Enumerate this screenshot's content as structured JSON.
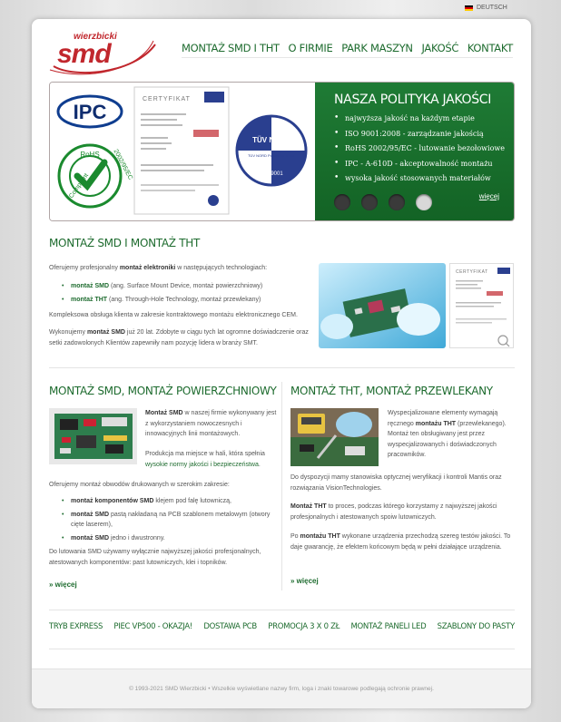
{
  "lang": {
    "label": "DEUTSCH"
  },
  "logo": {
    "top_word": "wierzbicki",
    "main_word": "smd"
  },
  "nav": [
    "MONTAŻ SMD I THT",
    "O FIRMIE",
    "PARK MASZYN",
    "JAKOŚĆ",
    "KONTAKT"
  ],
  "slider": {
    "title": "NASZA POLITYKA JAKOŚCI",
    "items": [
      "najwyższa jakość na każdym etapie",
      "ISO 9001:2008 - zarządzanie jakością",
      "RoHS 2002/95/EC - lutowanie bezołowiowe",
      "IPC - A-610D - akceptowalność montażu",
      "wysoka jakość stosowanych materiałów"
    ],
    "more": "więcej",
    "badges": {
      "ipc": "IPC",
      "rohs_top": "RoHS",
      "rohs_left": "Compliant",
      "rohs_right": "2002/95/EC",
      "cert": "CERTYFIKAT",
      "tuv": "TÜV NORD",
      "tuv_sub": "TÜV NORD Polska Sp. z o.o.",
      "iso": "ISO 9001"
    }
  },
  "section1": {
    "title": "MONTAŻ SMD I MONTAŻ THT",
    "intro_pre": "Oferujemy profesjonalny ",
    "intro_bold": "montaż elektroniki",
    "intro_post": " w następujących technologiach:",
    "b1_bold": "montaż SMD",
    "b1_rest": " (ang. Surface Mount Device, montaż powierzchniowy)",
    "b2_bold": "montaż THT",
    "b2_rest": " (ang. Through-Hole Technology, montaż przewlekany)",
    "p2": "Kompleksowa obsługa klienta w  zakresie kontraktowego montażu elektronicznego CEM.",
    "p3_pre": "Wykonujemy ",
    "p3_bold": "montaż SMD",
    "p3_post": " już 20 lat. Zdobyte w ciągu tych lat ogromne doświadczenie oraz setki zadowolonych Klientów zapewniły nam pozycję lidera w branży SMT.",
    "cert_label": "CERTYFIKAT"
  },
  "section2": {
    "title": "MONTAŻ SMD, MONTAŻ POWIERZCHNIOWY",
    "p1_bold": "Montaż SMD",
    "p1_rest": " w naszej firmie wykonywany jest z wykorzystaniem nowoczesnych i innowacyjnych linii montażowych.",
    "p2_pre": "Produkcja ma miejsce w hali, która spełnia ",
    "p2_link": "wysokie normy jakości i bezpieczeństwa",
    "p2_post": ".",
    "p3": "Oferujemy montaż obwodów drukowanych w szerokim zakresie:",
    "b1_bold": "montaż komponentów SMD",
    "b1_rest": " klejem pod falę lutowniczą,",
    "b2_bold": "montaż SMD",
    "b2_rest": " pastą nakładaną na PCB szablonem metalowym (otwory cięte laserem),",
    "b3_bold": "montaż SMD",
    "b3_rest": " jedno i dwustronny.",
    "p4": "Do lutowania SMD używamy wyłącznie najwyższej jakości profesjonalnych, atestowanych komponentów: past lutowniczych, klei i topników.",
    "more": "» więcej"
  },
  "section3": {
    "title": "MONTAŻ THT, MONTAŻ PRZEWLEKANY",
    "p1_pre": "Wyspecjalizowane elementy wymagają ręcznego ",
    "p1_bold": "montażu THT",
    "p1_post": " (przewlekanego). Montaż ten obsługiwany jest przez wyspecjalizowanych i doświadczonych pracowników.",
    "p2": "Do dyspozycji mamy stanowiska optycznej weryfikacji i kontroli Mantis oraz rozwiązania VisionTechnologies.",
    "p3_bold": "Montaż THT",
    "p3_rest": " to proces, podczas którego korzystamy z najwyższej jakości profesjonalnych i atestowanych spoiw lutowniczych.",
    "p4_pre": "Po ",
    "p4_bold": "montażu THT",
    "p4_post": " wykonane urządzenia przechodzą szereg testów jakości. To daje gwarancję, że efektem końcowym będą w pełni działające urządzenia.",
    "more": "» więcej"
  },
  "bottom_links": [
    "TRYB EXPRESS",
    "PIEC VP500 - OKAZJA!",
    "DOSTAWA PCB",
    "PROMOCJA 3 x 0 zł",
    "MONTAŻ PANELI LED",
    "SZABLONY DO PASTY"
  ],
  "footer": "© 1993-2021 SMD Wierzbicki • Wszelkie wyświetlane nazwy firm, loga i znaki towarowe podlegają ochronie prawnej.",
  "colors": {
    "brand_green": "#1d6b2e",
    "logo_red": "#c1272d"
  }
}
